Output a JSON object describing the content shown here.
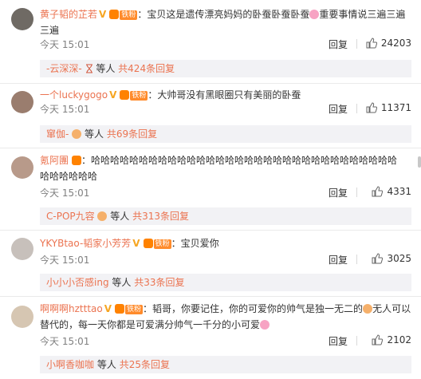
{
  "comments": [
    {
      "username": "黄子韬的芷若",
      "vip": "V",
      "tie_badge": "铁粉",
      "text_line1": "宝贝这是遗传漂亮妈妈的卧蚕卧蚕卧蚕",
      "text_line1b": "重要事情说三遍三遍",
      "text_line2": "三遍",
      "time": "今天 15:01",
      "reply_label": "回复",
      "likes": "24203",
      "sub_user": "-云深深-",
      "sub_mid": "等人",
      "sub_count": "共424条回复",
      "avatar_color": "#6f6a64"
    },
    {
      "username": "一个luckygogo",
      "vip": "V",
      "tie_badge": "铁粉",
      "text_line1": "大帅哥没有黑眼圈只有美丽的卧蚕",
      "time": "今天 15:01",
      "reply_label": "回复",
      "likes": "11371",
      "sub_user": "窜伽-",
      "sub_mid": "等人",
      "sub_count": "共69条回复",
      "avatar_color": "#9a7d6e"
    },
    {
      "username": "氪阿團",
      "text_line1": "哈哈哈哈哈哈哈哈哈哈哈哈哈哈哈哈哈哈哈哈哈哈哈哈哈哈哈哈哈哈哈哈",
      "text_line2": "哈哈哈哈哈哈",
      "time": "今天 15:01",
      "reply_label": "回复",
      "likes": "4331",
      "sub_user": "C-POP九容",
      "sub_mid": "等人",
      "sub_count": "共313条回复",
      "avatar_color": "#b89a8a"
    },
    {
      "username": "YKYBtao-韬家小芳芳",
      "vip": "V",
      "tie_badge": "铁粉",
      "text_line1": "宝贝爱你",
      "time": "今天 15:01",
      "reply_label": "回复",
      "likes": "3025",
      "sub_user": "小小小否感ing",
      "sub_mid": "等人",
      "sub_count": "共33条回复",
      "avatar_color": "#c7c0bb"
    },
    {
      "username": "啊啊啊hztttao",
      "vip": "V",
      "tie_badge": "铁粉",
      "text_line1": "韬哥，你要记住，你的可爱你的帅气是独一无二的",
      "text_line1b": "无人可以",
      "text_line2": "替代的，每一天你都是可爱满分帅气一千分的小可爱",
      "time": "今天 15:01",
      "reply_label": "回复",
      "likes": "2102",
      "sub_user": "小啊香咖咖",
      "sub_mid": "等人",
      "sub_count": "共25条回复",
      "avatar_color": "#d6c6b2"
    }
  ],
  "colors": {
    "username": "#eb7350",
    "vip": "#f6a623",
    "subbar_bg": "#f2f2f5"
  }
}
